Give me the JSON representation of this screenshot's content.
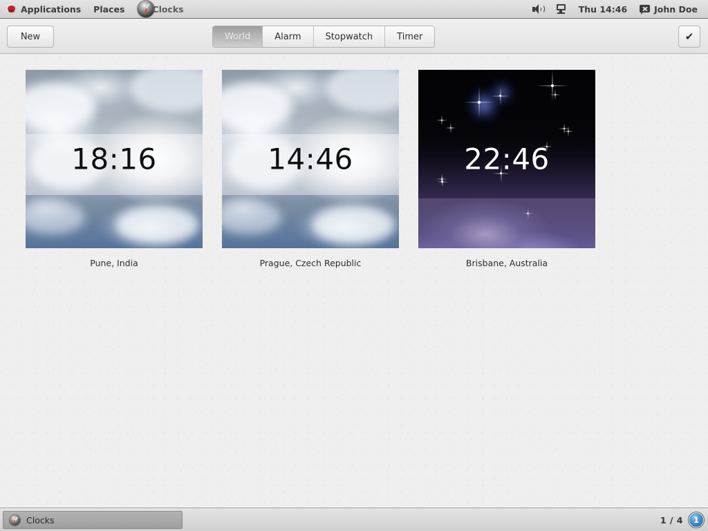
{
  "panel": {
    "menus": [
      {
        "label": "Applications",
        "icon": "redhat-icon"
      },
      {
        "label": "Places",
        "icon": null
      }
    ],
    "app_title": "Clocks",
    "app_icon": "clock-icon",
    "volume_icon": "volume-icon",
    "display_icon": "display-icon",
    "clock": "Thu 14:46",
    "user_icon": "chat-bubble-icon",
    "user": "John Doe"
  },
  "toolbar": {
    "new_label": "New",
    "done_icon": "check-icon",
    "tabs": [
      {
        "label": "World",
        "active": true
      },
      {
        "label": "Alarm",
        "active": false
      },
      {
        "label": "Stopwatch",
        "active": false
      },
      {
        "label": "Timer",
        "active": false
      }
    ]
  },
  "clocks": [
    {
      "time": "18:16",
      "label": "Pune, India",
      "daylight": "day"
    },
    {
      "time": "14:46",
      "label": "Prague, Czech Republic",
      "daylight": "day"
    },
    {
      "time": "22:46",
      "label": "Brisbane, Australia",
      "daylight": "night"
    }
  ],
  "taskbar": {
    "window_title": "Clocks",
    "window_icon": "clock-icon",
    "workspace_count": "1 / 4",
    "workspace_current": "1"
  },
  "colors": {
    "panel_bg": "#dcdcdc",
    "content_bg": "#efefef",
    "tab_active_bg": "#b5b5b5",
    "workspace_badge": "#4f95d2",
    "night_sky": "#050509",
    "day_sky": "#aeb8c4"
  }
}
